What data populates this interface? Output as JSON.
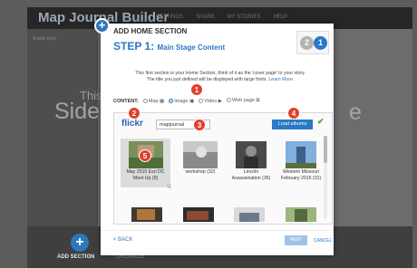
{
  "app": {
    "title": "Map Journal Builder",
    "top_links": [
      "SETTINGS",
      "SHARE",
      "MY STORIES",
      "HELP"
    ],
    "crumb": "A web story",
    "bg_text_1": "This",
    "bg_text_2": "Side",
    "bg_text_3": "e",
    "add_section_label": "ADD SECTION",
    "organize_label": "ORGANIZE"
  },
  "dialog": {
    "title": "ADD HOME SECTION",
    "step_label": "STEP 1:",
    "step_sub": "Main Stage Content",
    "step_current": "1",
    "step_next": "2",
    "description_1": "This first section is your Home Section, think of it as the 'cover page' to your story.",
    "description_2": "The title you just defined will be displayed with large fonts.",
    "learn_more": "Learn More.",
    "content_label": "CONTENT:",
    "content_options": [
      "Map",
      "Image",
      "Video",
      "Web page"
    ],
    "content_selected": "Image",
    "flickr_logo": "flickr",
    "search_value": "mapjournal",
    "load_button": "Load albums",
    "albums": [
      {
        "label": "May 2015 Esri DC Meet Up (9)"
      },
      {
        "label": "workshop (32)"
      },
      {
        "label": "Lincoln Assassination (36)"
      },
      {
        "label": "Western Missouri February 2015 (31)"
      }
    ],
    "back_label": "< BACK",
    "next_label": "NEXT",
    "cancel_label": "CANCEL"
  },
  "badges": [
    "1",
    "2",
    "3",
    "4",
    "5"
  ],
  "colors": {
    "accent": "#2b78c5",
    "badge": "#e2402b",
    "flickr_blue": "#2f64b7",
    "flickr_pink": "#e8398a"
  }
}
